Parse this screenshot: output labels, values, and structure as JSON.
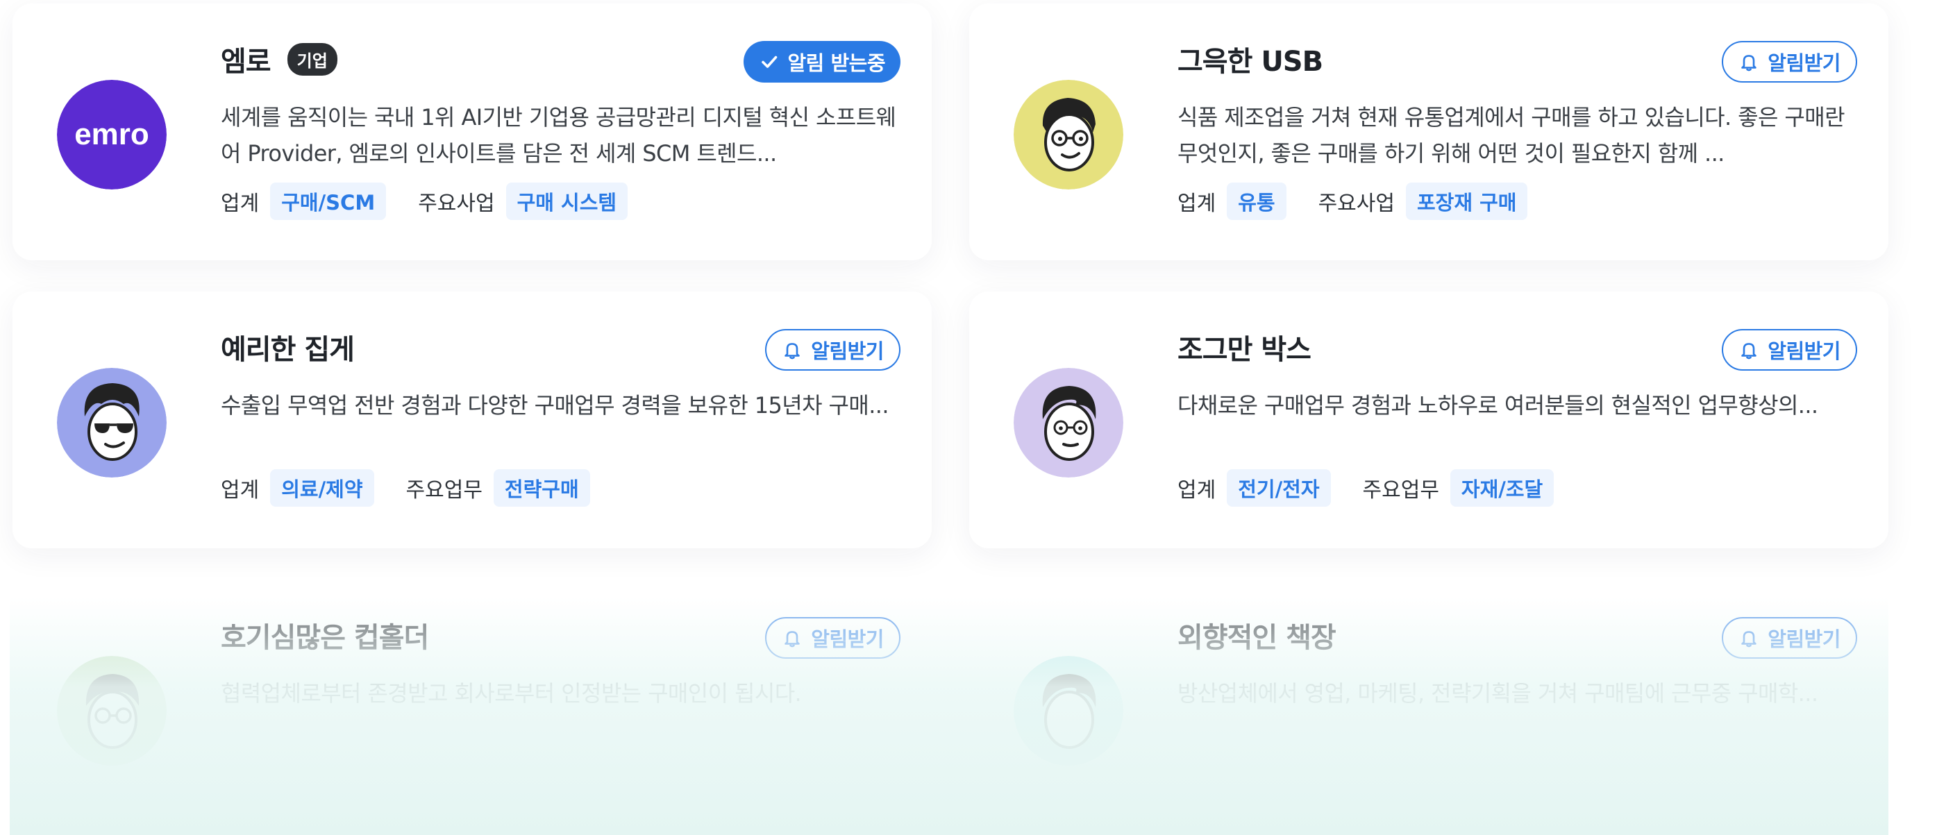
{
  "cards": [
    {
      "name": "엠로",
      "badge": "기업",
      "avatar_icon": "emro-logo-icon",
      "avatar_text": "emro",
      "avatar_color": "#5b2bd1",
      "button_label": "알림 받는중",
      "button_state": "subscribed",
      "description": "세계를 움직이는 국내 1위 AI기반 기업용 공급망관리 디지털 혁신 소프트웨어 Provider, 엠로의 인사이트를 담은 전 세계 SCM 트렌드...",
      "tag1_label": "업계",
      "tag1_value": "구매/SCM",
      "tag2_label": "주요사업",
      "tag2_value": "구매 시스템"
    },
    {
      "name": "그윽한 USB",
      "avatar_icon": "person-glasses-avatar-icon",
      "avatar_color": "#e6e17e",
      "button_label": "알림받기",
      "button_state": "not-subscribed",
      "description": "식품 제조업을 거쳐 현재 유통업계에서 구매를 하고 있습니다. 좋은 구매란 무엇인지, 좋은 구매를 하기 위해 어떤 것이 필요한지 함께 ...",
      "tag1_label": "업계",
      "tag1_value": "유통",
      "tag2_label": "주요사업",
      "tag2_value": "포장재 구매"
    },
    {
      "name": "예리한 집게",
      "avatar_icon": "person-sunglasses-avatar-icon",
      "avatar_color": "#9aa4ec",
      "button_label": "알림받기",
      "button_state": "not-subscribed",
      "description": "수출입 무역업 전반 경험과 다양한 구매업무 경력을 보유한 15년차 구매...",
      "tag1_label": "업계",
      "tag1_value": "의료/제약",
      "tag2_label": "주요업무",
      "tag2_value": "전략구매"
    },
    {
      "name": "조그만 박스",
      "avatar_icon": "person-avatar-icon",
      "avatar_color": "#d3c8ef",
      "button_label": "알림받기",
      "button_state": "not-subscribed",
      "description": "다채로운 구매업무 경험과 노하우로 여러분들의 현실적인 업무향상의...",
      "tag1_label": "업계",
      "tag1_value": "전기/전자",
      "tag2_label": "주요업무",
      "tag2_value": "자재/조달"
    },
    {
      "name": "호기심많은 컵홀더",
      "avatar_icon": "person-glasses-avatar-icon",
      "avatar_color": "#b7d8a9",
      "button_label": "알림받기",
      "button_state": "not-subscribed",
      "description": "협력업체로부터 존경받고 회사로부터 인정받는 구매인이 됩시다."
    },
    {
      "name": "외향적인 책장",
      "avatar_icon": "person-avatar-icon",
      "avatar_color": "#aee7e6",
      "button_label": "알림받기",
      "button_state": "not-subscribed",
      "description": "방산업체에서 영업, 마케팅, 전략기획을 거쳐 구매팀에 근무중 구매학..."
    }
  ]
}
